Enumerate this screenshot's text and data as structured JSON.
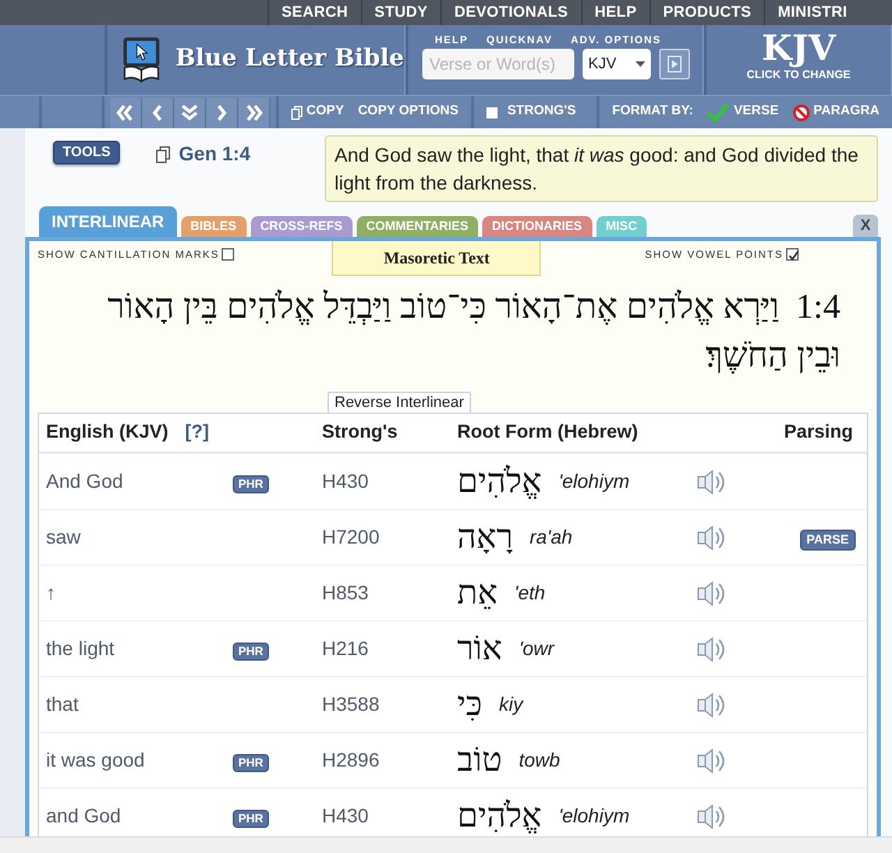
{
  "top_nav": [
    "SEARCH",
    "STUDY",
    "DEVOTIONALS",
    "HELP",
    "PRODUCTS",
    "MINISTRI"
  ],
  "header": {
    "logo_text": "Blue Letter Bible",
    "search_labels": [
      "HELP",
      "QUICKNAV",
      "ADV. OPTIONS"
    ],
    "search": {
      "placeholder": "Verse or Word(s)"
    },
    "version_select": "KJV",
    "version_badge": {
      "title": "KJV",
      "subtitle": "CLICK TO CHANGE"
    }
  },
  "toolbar": {
    "copy": "COPY",
    "copy_options": "COPY OPTIONS",
    "strongs": {
      "label": "STRONG'S",
      "checked": false
    },
    "format_label": "FORMAT BY:",
    "format_options": [
      {
        "label": "VERSE",
        "selected": true
      },
      {
        "label": "PARAGRA",
        "selected": false
      }
    ]
  },
  "tools_button": "TOOLS",
  "reference": "Gen 1:4",
  "verse_text": "And God saw the light, that *it was* good: and God divided the light from the darkness.",
  "tabs": [
    {
      "label": "INTERLINEAR",
      "selected": true,
      "color": "#5aa0d8"
    },
    {
      "label": "BIBLES",
      "selected": false,
      "color": "#e3a06a"
    },
    {
      "label": "CROSS-REFS",
      "selected": false,
      "color": "#a99ad0"
    },
    {
      "label": "COMMENTARIES",
      "selected": false,
      "color": "#8fb064"
    },
    {
      "label": "DICTIONARIES",
      "selected": false,
      "color": "#d88780"
    },
    {
      "label": "MISC",
      "selected": false,
      "color": "#72cfd0"
    }
  ],
  "close_button": "X",
  "interlinear": {
    "cantillation": {
      "label": "SHOW CANTILLATION MARKS",
      "checked": false
    },
    "text_tab": "Masoretic Text",
    "vowel_points": {
      "label": "SHOW VOWEL POINTS",
      "checked": true
    },
    "verse_number": "1:4",
    "hebrew_verse": "וַיַּרְא אֱלֹהִים אֶת־הָאוֹר כִּי־טוֹב וַיַּבְדֵּל אֱלֹהִים בֵּין הָאוֹר וּבֵין הַחֹשֶׁךְ׃",
    "reverse_tab": "Reverse Interlinear"
  },
  "table": {
    "columns": [
      "English (KJV)",
      "[?]",
      "Strong's",
      "Root Form (Hebrew)",
      "Parsing"
    ],
    "rows": [
      {
        "english": "And God",
        "phrase": "PHR",
        "strongs": "H430",
        "hebrew": "אֱלֹהִים",
        "translit": "'elohiym"
      },
      {
        "english": "saw",
        "strongs": "H7200",
        "hebrew": "רָאָה",
        "translit": "ra'ah",
        "parse": "PARSE"
      },
      {
        "english": "↑",
        "strongs": "H853",
        "hebrew": "אֵת",
        "translit": "'eth"
      },
      {
        "english": "the light",
        "phrase": "PHR",
        "strongs": "H216",
        "hebrew": "אוֹר",
        "translit": "'owr"
      },
      {
        "english": "that",
        "strongs": "H3588",
        "hebrew": "כִּי",
        "translit": "kiy"
      },
      {
        "english": "it was good",
        "phrase": "PHR",
        "strongs": "H2896",
        "hebrew": "טוֹב",
        "translit": "towb"
      },
      {
        "english": "and God",
        "phrase": "PHR",
        "strongs": "H430",
        "hebrew": "אֱלֹהִים",
        "translit": "'elohiym"
      }
    ]
  }
}
